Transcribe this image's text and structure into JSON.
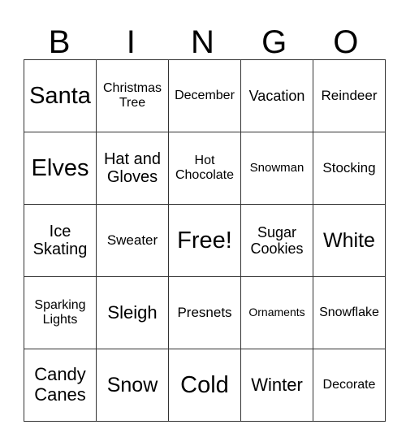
{
  "header": [
    "B",
    "I",
    "N",
    "G",
    "O"
  ],
  "rows": [
    [
      {
        "text": "Santa",
        "size": "s40"
      },
      {
        "text": "Christmas Tree",
        "size": "s16"
      },
      {
        "text": "December",
        "size": "s16"
      },
      {
        "text": "Vacation",
        "size": "s20"
      },
      {
        "text": "Reindeer",
        "size": "s18"
      }
    ],
    [
      {
        "text": "Elves",
        "size": "s40"
      },
      {
        "text": "Hat and Gloves",
        "size": "s22"
      },
      {
        "text": "Hot Chocolate",
        "size": "s16"
      },
      {
        "text": "Snowman",
        "size": "s15"
      },
      {
        "text": "Stocking",
        "size": "s18"
      }
    ],
    [
      {
        "text": "Ice Skating",
        "size": "s22"
      },
      {
        "text": "Sweater",
        "size": "s18"
      },
      {
        "text": "Free!",
        "size": "s40"
      },
      {
        "text": "Sugar Cookies",
        "size": "s20"
      },
      {
        "text": "White",
        "size": "s32"
      }
    ],
    [
      {
        "text": "Sparking Lights",
        "size": "s16"
      },
      {
        "text": "Sleigh",
        "size": "s28"
      },
      {
        "text": "Presnets",
        "size": "s18"
      },
      {
        "text": "Ornaments",
        "size": "s14"
      },
      {
        "text": "Snowflake",
        "size": "s16"
      }
    ],
    [
      {
        "text": "Candy Canes",
        "size": "s28"
      },
      {
        "text": "Snow",
        "size": "s32"
      },
      {
        "text": "Cold",
        "size": "s40"
      },
      {
        "text": "Winter",
        "size": "s28"
      },
      {
        "text": "Decorate",
        "size": "s16"
      }
    ]
  ]
}
